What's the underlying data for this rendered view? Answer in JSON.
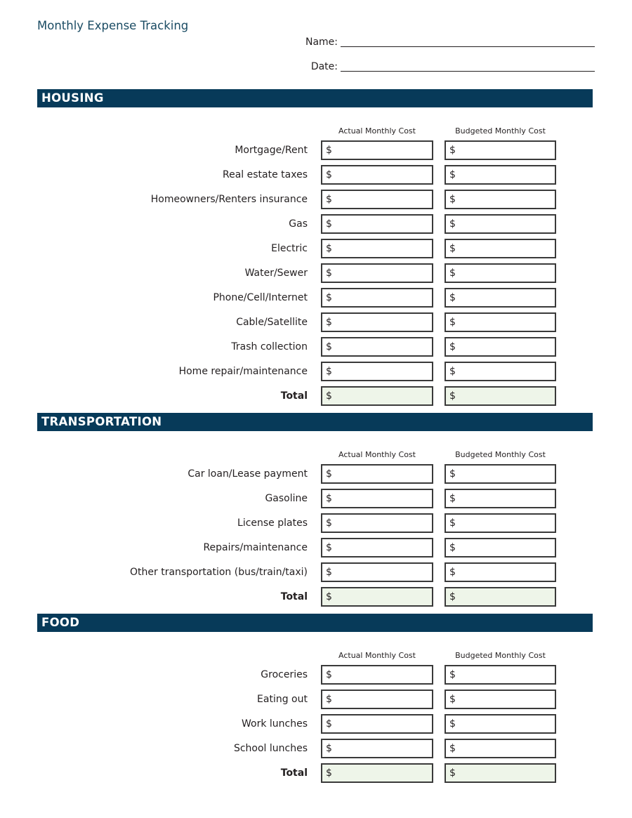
{
  "title": "Monthly Expense Tracking",
  "header_fields": {
    "name_label": "Name:",
    "name_value": "",
    "date_label": "Date:",
    "date_value": ""
  },
  "columns": {
    "actual": "Actual Monthly Cost",
    "budgeted": "Budgeted Monthly Cost"
  },
  "currency_symbol": "$",
  "colors": {
    "banner": "#073a59",
    "title": "#1a4b63",
    "total_fill": "#eef5e9"
  },
  "sections": [
    {
      "id": "housing",
      "title": "HOUSING",
      "items": [
        "Mortgage/Rent",
        "Real estate taxes",
        "Homeowners/Renters insurance",
        "Gas",
        "Electric",
        "Water/Sewer",
        "Phone/Cell/Internet",
        "Cable/Satellite",
        "Trash collection",
        "Home repair/maintenance"
      ],
      "total_label": "Total"
    },
    {
      "id": "transportation",
      "title": "TRANSPORTATION",
      "items": [
        "Car loan/Lease payment",
        "Gasoline",
        "License plates",
        "Repairs/maintenance",
        "Other transportation (bus/train/taxi)"
      ],
      "total_label": "Total"
    },
    {
      "id": "food",
      "title": "FOOD",
      "items": [
        "Groceries",
        "Eating out",
        "Work lunches",
        "School lunches"
      ],
      "total_label": "Total"
    }
  ]
}
